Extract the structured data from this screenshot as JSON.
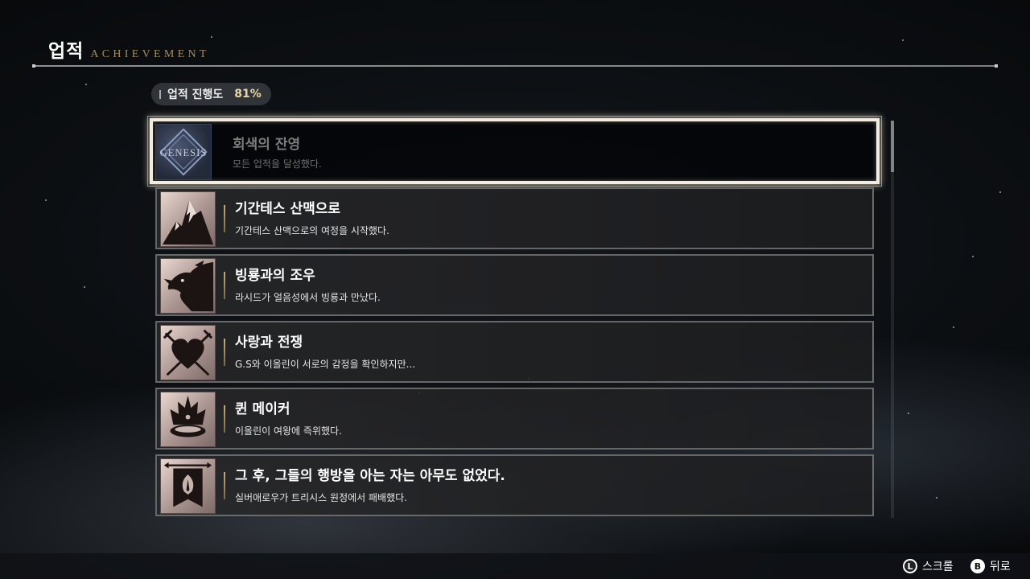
{
  "header": {
    "title_ko": "업적",
    "title_en": "ACHIEVEMENT"
  },
  "progress": {
    "label": "업적 진행도",
    "value": "81%"
  },
  "achievements": [
    {
      "title": "회색의 잔영",
      "desc": "모든 업적을 달성했다.",
      "icon": "genesis-logo-icon",
      "selected": true,
      "icon_text": "GENESIS"
    },
    {
      "title": "기간테스 산맥으로",
      "desc": "기간테스 산맥으로의 여정을 시작했다.",
      "icon": "mountain-icon"
    },
    {
      "title": "빙룡과의 조우",
      "desc": "라시드가 얼음성에서 빙룡과 만났다.",
      "icon": "dragon-icon"
    },
    {
      "title": "사랑과 전쟁",
      "desc": "G.S와 이올린이 서로의 감정을 확인하지만...",
      "icon": "heart-swords-icon"
    },
    {
      "title": "퀸 메이커",
      "desc": "이올린이 여왕에 즉위했다.",
      "icon": "crown-icon"
    },
    {
      "title": "그 후, 그들의 행방을 아는 자는 아무도 없었다.",
      "desc": "실버애로우가 트리시스 원정에서 패배했다.",
      "icon": "banner-emblem-icon"
    }
  ],
  "footer": {
    "scroll": {
      "button": "L",
      "label": "스크롤"
    },
    "back": {
      "button": "B",
      "label": "뒤로"
    }
  },
  "colors": {
    "accent_gold": "#e8d7a2",
    "header_en": "#a48c5e",
    "highlight": "#f2ece0"
  }
}
